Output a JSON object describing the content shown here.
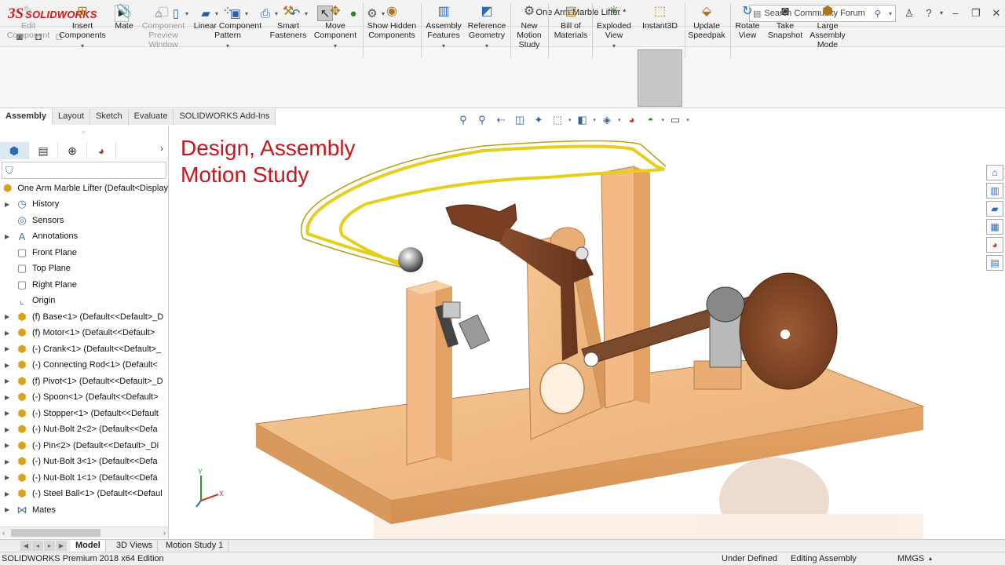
{
  "app": {
    "brand": "SOLIDWORKS",
    "document_title": "One Arm Marble Lifter *",
    "search_placeholder": "Search Community Forum"
  },
  "ribbon": [
    {
      "label": "Edit Component",
      "icon": "edit-component-icon",
      "disabled": true
    },
    {
      "label": "Insert Components",
      "icon": "insert-components-icon"
    },
    {
      "label": "Mate",
      "icon": "mate-icon"
    },
    {
      "label": "Component Preview Window",
      "icon": "component-preview-icon",
      "disabled": true
    },
    {
      "label": "Linear Component Pattern",
      "icon": "linear-pattern-icon"
    },
    {
      "label": "Smart Fasteners",
      "icon": "smart-fasteners-icon"
    },
    {
      "label": "Move Component",
      "icon": "move-component-icon"
    },
    {
      "label": "Show Hidden Components",
      "icon": "show-hidden-icon"
    },
    {
      "label": "Assembly Features",
      "icon": "assembly-features-icon"
    },
    {
      "label": "Reference Geometry",
      "icon": "reference-geometry-icon"
    },
    {
      "label": "New Motion Study",
      "icon": "motion-study-icon"
    },
    {
      "label": "Bill of Materials",
      "icon": "bom-icon"
    },
    {
      "label": "Exploded View",
      "icon": "exploded-view-icon"
    },
    {
      "label": "Instant3D",
      "icon": "instant3d-icon",
      "active": true
    },
    {
      "label": "Update Speedpak",
      "icon": "speedpak-icon"
    },
    {
      "label": "Rotate View",
      "icon": "rotate-view-icon"
    },
    {
      "label": "Take Snapshot",
      "icon": "snapshot-icon"
    },
    {
      "label": "Large Assembly Mode",
      "icon": "large-assembly-icon"
    }
  ],
  "command_tabs": [
    "Assembly",
    "Layout",
    "Sketch",
    "Evaluate",
    "SOLIDWORKS Add-Ins"
  ],
  "feature_tree": {
    "root": "One Arm Marble Lifter  (Default<Display",
    "items": [
      {
        "label": "History",
        "kind": "other",
        "expandable": true
      },
      {
        "label": "Sensors",
        "kind": "other",
        "expandable": false
      },
      {
        "label": "Annotations",
        "kind": "other",
        "expandable": true
      },
      {
        "label": "Front Plane",
        "kind": "plane",
        "expandable": false
      },
      {
        "label": "Top Plane",
        "kind": "plane",
        "expandable": false
      },
      {
        "label": "Right Plane",
        "kind": "plane",
        "expandable": false
      },
      {
        "label": "Origin",
        "kind": "other",
        "expandable": false
      },
      {
        "label": "(f) Base<1> (Default<<Default>_D",
        "kind": "part",
        "expandable": true
      },
      {
        "label": "(f) Motor<1> (Default<<Default>",
        "kind": "part",
        "expandable": true
      },
      {
        "label": "(-) Crank<1> (Default<<Default>_",
        "kind": "part",
        "expandable": true
      },
      {
        "label": "(-) Connecting Rod<1> (Default<",
        "kind": "part",
        "expandable": true
      },
      {
        "label": "(f) Pivot<1> (Default<<Default>_D",
        "kind": "part",
        "expandable": true
      },
      {
        "label": "(-) Spoon<1> (Default<<Default>",
        "kind": "part",
        "expandable": true
      },
      {
        "label": "(-) Stopper<1> (Default<<Default",
        "kind": "part",
        "expandable": true
      },
      {
        "label": "(-) Nut-Bolt 2<2> (Default<<Defa",
        "kind": "part",
        "expandable": true
      },
      {
        "label": "(-) Pin<2> (Default<<Default>_Di",
        "kind": "part",
        "expandable": true
      },
      {
        "label": "(-) Nut-Bolt 3<1> (Default<<Defa",
        "kind": "part",
        "expandable": true
      },
      {
        "label": "(-) Nut-Bolt 1<1> (Default<<Defa",
        "kind": "part",
        "expandable": true
      },
      {
        "label": "(-) Steel Ball<1> (Default<<Defaul",
        "kind": "part",
        "expandable": true
      },
      {
        "label": "Mates",
        "kind": "other",
        "expandable": true
      }
    ]
  },
  "viewport": {
    "overlay_line1": "Design, Assembly",
    "overlay_line2": "Motion Study"
  },
  "bottom_tabs": [
    "Model",
    "3D Views",
    "Motion Study 1"
  ],
  "status": {
    "edition": "SOLIDWORKS Premium 2018 x64 Edition",
    "state": "Under Defined",
    "mode": "Editing Assembly",
    "units": "MMGS"
  }
}
